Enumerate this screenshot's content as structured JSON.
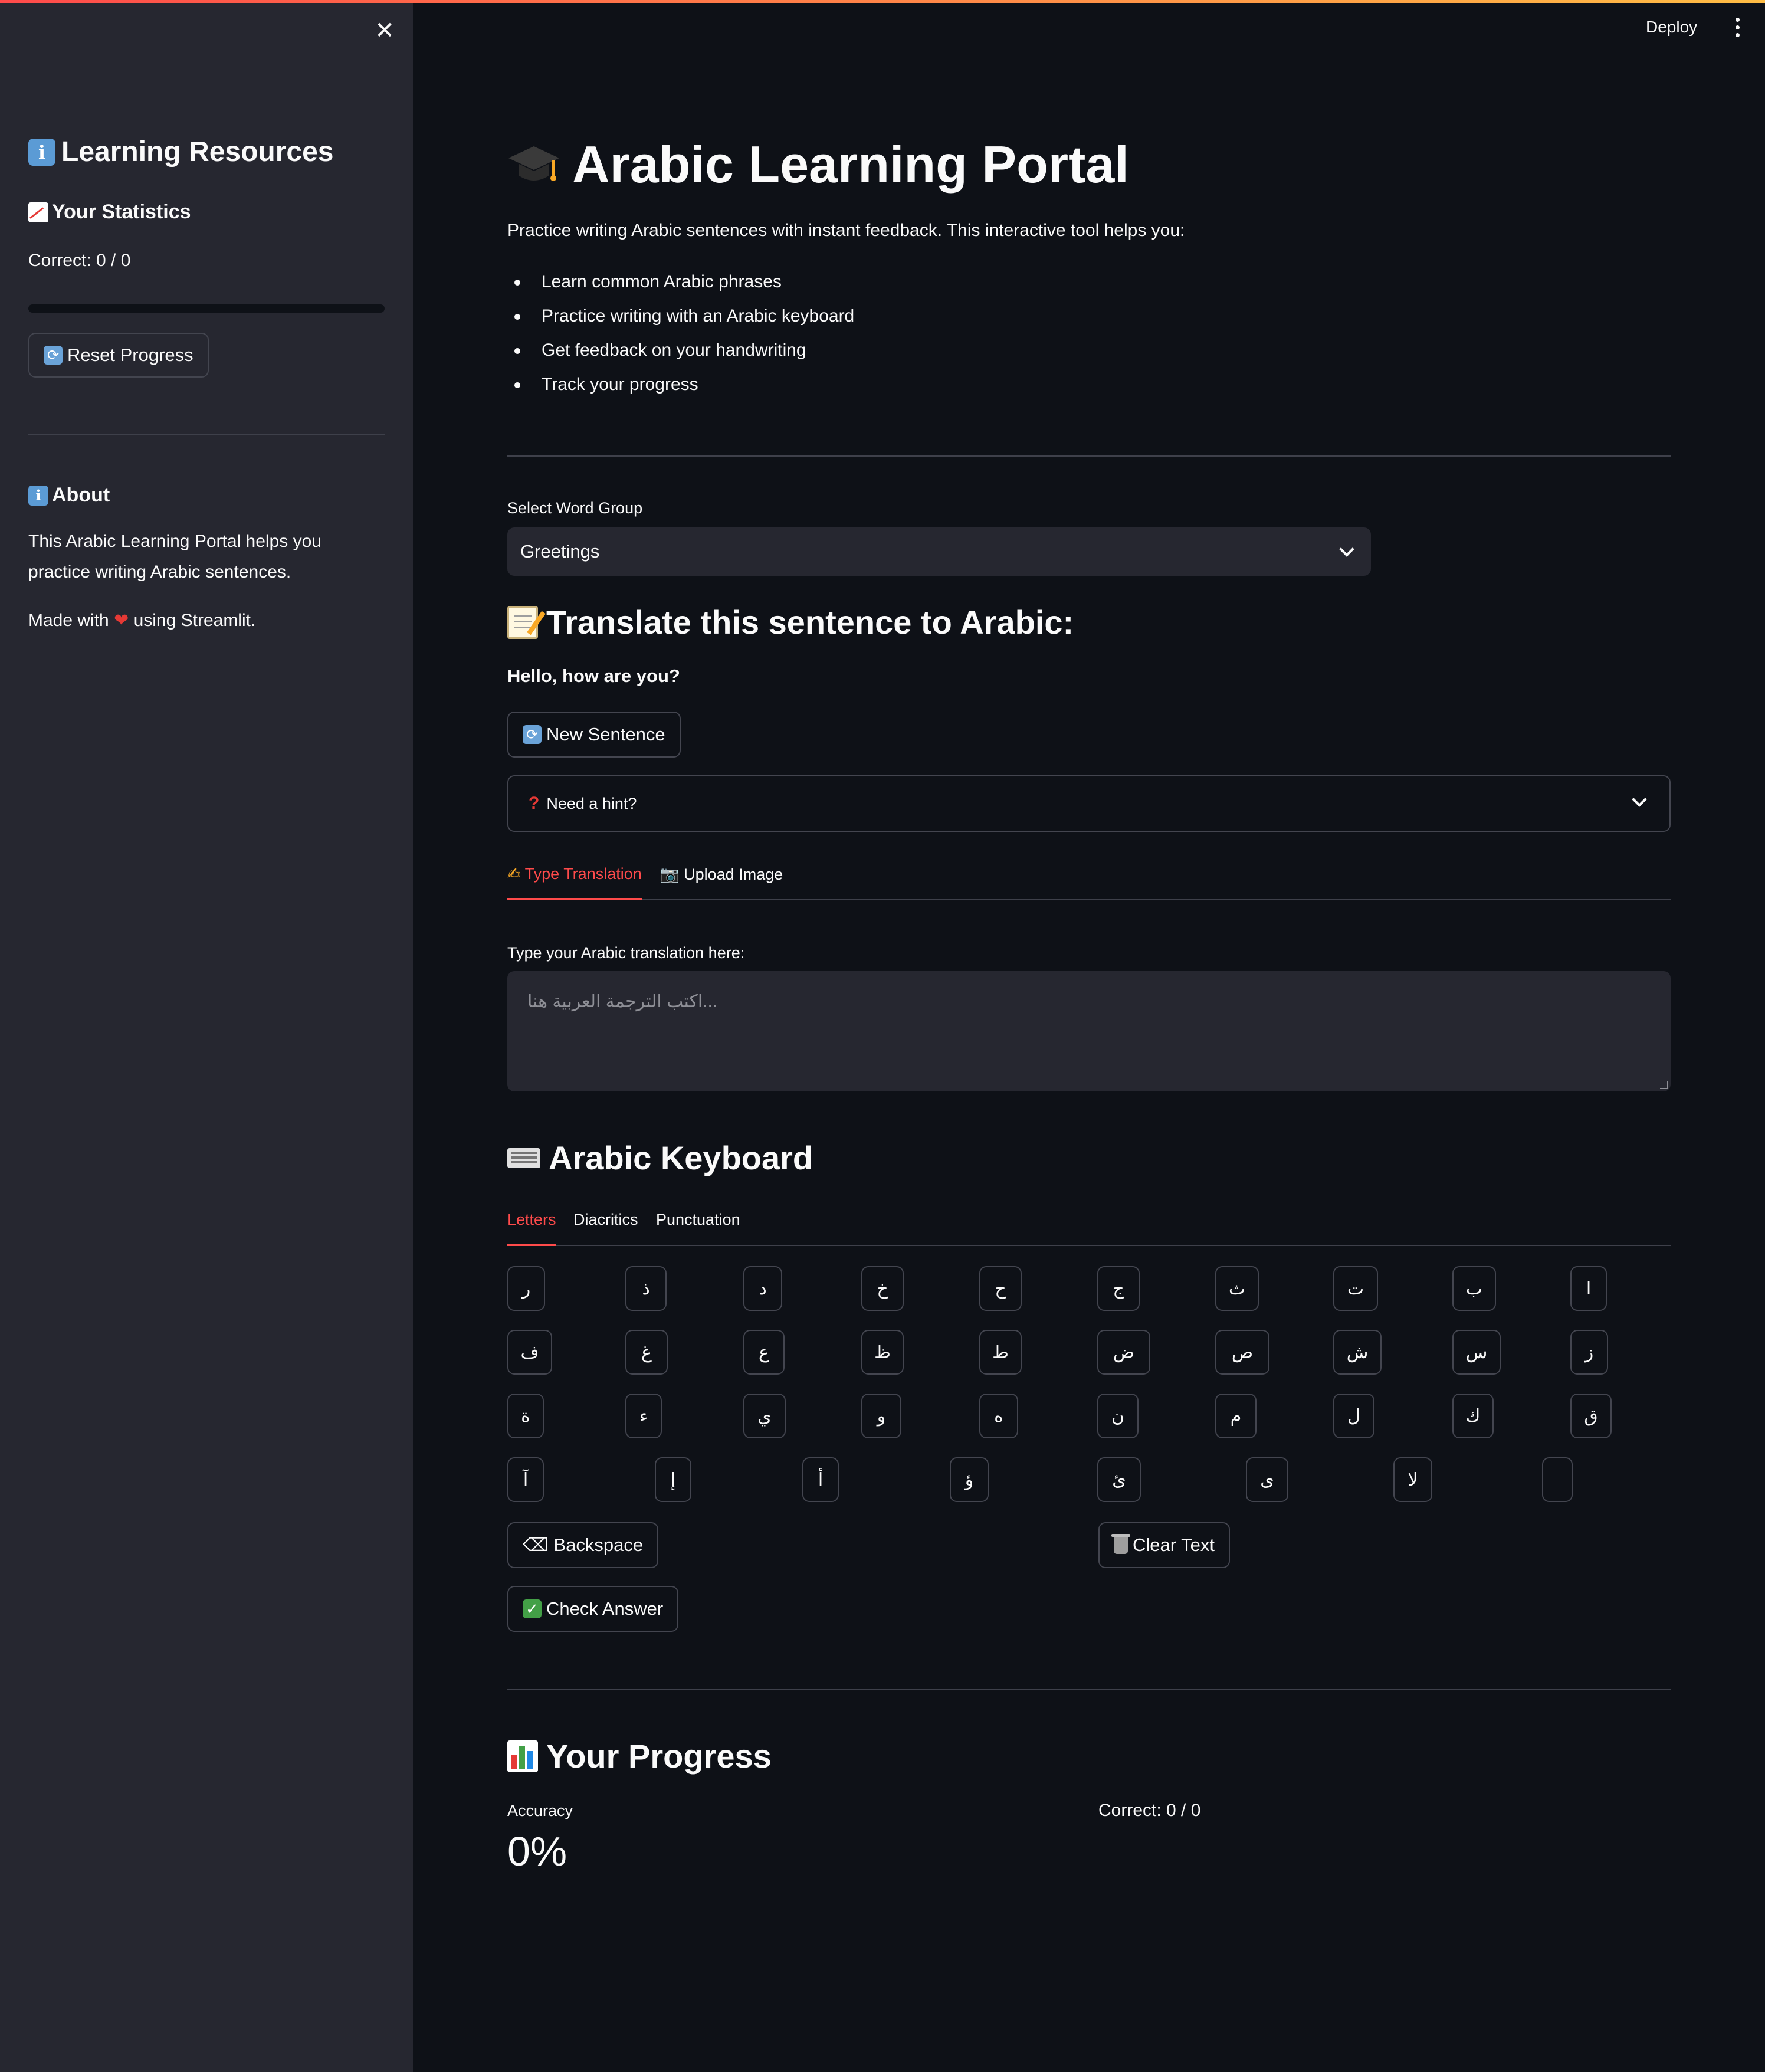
{
  "header": {
    "deploy_label": "Deploy",
    "menu_icon": "kebab-menu-icon"
  },
  "sidebar": {
    "close_icon": "close-icon",
    "resources_title": "Learning Resources",
    "stats_title": "Your Statistics",
    "correct_text": "Correct: 0 / 0",
    "progress_fraction": 0,
    "reset_label": "Reset Progress",
    "about_title": "About",
    "about_text_line1": "This Arabic Learning Portal helps you",
    "about_text_line2": "practice writing Arabic sentences.",
    "made_with_prefix": "Made with",
    "made_with_suffix": "using Streamlit."
  },
  "main": {
    "title": "Arabic Learning Portal",
    "intro": "Practice writing Arabic sentences with instant feedback. This interactive tool helps you:",
    "bullets": [
      "Learn common Arabic phrases",
      "Practice writing with an Arabic keyboard",
      "Get feedback on your handwriting",
      "Track your progress"
    ],
    "word_group_label": "Select Word Group",
    "word_group_value": "Greetings",
    "translate_heading": "Translate this sentence to Arabic:",
    "sentence": "Hello, how are you?",
    "new_sentence_label": "New Sentence",
    "hint_label": "Need a hint?",
    "input_tabs": [
      "Type Translation",
      "Upload Image"
    ],
    "textarea_label": "Type your Arabic translation here:",
    "textarea_placeholder": "...اكتب الترجمة العربية هنا",
    "keyboard_heading": "Arabic Keyboard",
    "keyboard_tabs": [
      "Letters",
      "Diacritics",
      "Punctuation"
    ],
    "keys_row1": [
      "ر",
      "ذ",
      "د",
      "خ",
      "ح",
      "ج",
      "ث",
      "ت",
      "ب",
      "ا"
    ],
    "keys_row2": [
      "ف",
      "غ",
      "ع",
      "ظ",
      "ط",
      "ض",
      "ص",
      "ش",
      "س",
      "ز"
    ],
    "keys_row3": [
      "ة",
      "ء",
      "ي",
      "و",
      "ه",
      "ن",
      "م",
      "ل",
      "ك",
      "ق"
    ],
    "keys_row4": [
      "آ",
      "إ",
      "أ",
      "ؤ",
      "ئ",
      "ى",
      "لا",
      ""
    ],
    "backspace_label": "⌫ Backspace",
    "clear_label": "Clear Text",
    "check_label": "Check Answer",
    "progress_heading": "Your Progress",
    "accuracy_label": "Accuracy",
    "accuracy_value": "0%",
    "correct_text": "Correct: 0 / 0"
  },
  "colors": {
    "accent": "#ff4b4b",
    "background": "#0e1117",
    "sidebar": "#262730"
  }
}
